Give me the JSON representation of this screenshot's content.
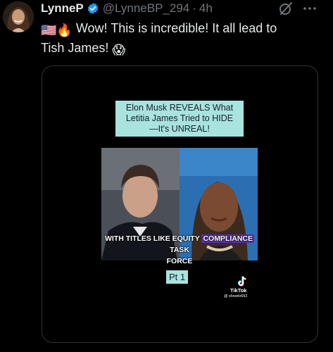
{
  "post": {
    "display_name": "LynneP",
    "handle": "@LynneBP_294",
    "separator": "·",
    "time": "4h",
    "text_line1": "Wow! This is incredible! It all lead to",
    "text_line2": "Tish James!",
    "leading_emojis": "🇺🇸🔥",
    "trailing_emoji": "😱"
  },
  "media": {
    "title_line1": "Elon Musk REVEALS What",
    "title_line2": "Letitia James Tried to HIDE",
    "title_line3": "—It's UNREAL!",
    "caption_before": "WITH TITLES LIKE EQUITY ",
    "caption_highlight": "COMPLIANCE",
    "caption_after": " TASK",
    "caption_line2": "FORCE",
    "part_label": "Pt 1",
    "tiktok_label": "TikTok",
    "tiktok_user": "@ showtv692"
  },
  "icons": {
    "verified": "verified-badge-icon",
    "grok": "grok-icon",
    "more": "more-icon",
    "tiktok": "tiktok-logo-icon"
  },
  "colors": {
    "background": "#000000",
    "text": "#e7e9ea",
    "muted": "#71767b",
    "verified": "#1d9bf0",
    "title_bg": "#a8e3e0",
    "caption_highlight": "#5b2fb5"
  }
}
